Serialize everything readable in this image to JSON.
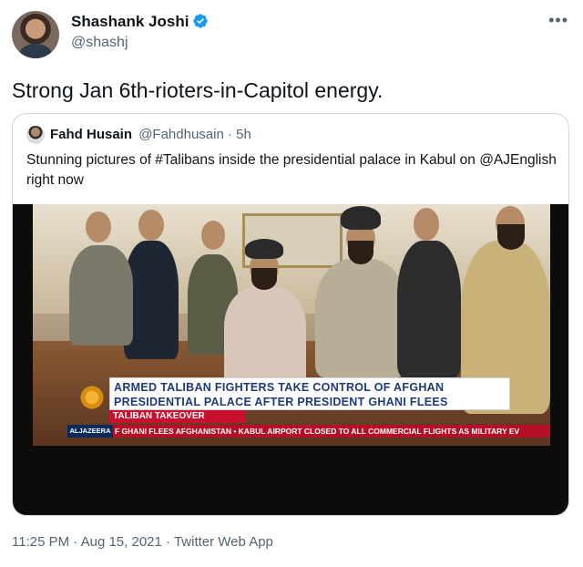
{
  "tweet": {
    "author": {
      "name": "Shashank Joshi",
      "handle": "@shashj",
      "verified": true
    },
    "more_icon": "more-horizontal-icon",
    "text": "Strong Jan 6th-rioters-in-Capitol energy.",
    "quote": {
      "author_name": "Fahd Husain",
      "author_handle": "@Fahdhusain",
      "separator": "·",
      "time": "5h",
      "text": "Stunning pictures of #Talibans inside the presidential palace in Kabul on @AJEnglish right now",
      "media": {
        "headline_line1": "ARMED TALIBAN FIGHTERS TAKE CONTROL OF AFGHAN",
        "headline_line2": "PRESIDENTIAL PALACE AFTER PRESIDENT GHANI FLEES",
        "banner": "TALIBAN TAKEOVER",
        "channel_logo": "ALJAZEERA",
        "ticker": "F GHANI FLEES AFGHANISTAN  •  KABUL AIRPORT CLOSED TO ALL COMMERCIAL FLIGHTS AS MILITARY EV"
      }
    },
    "footer": {
      "time": "11:25 PM",
      "separator": "·",
      "date": "Aug 15, 2021",
      "source": "Twitter Web App"
    }
  },
  "colors": {
    "verified": "#1d9bf0",
    "secondary_text": "#536471",
    "border": "#cfd9de",
    "news_red": "#c8102e"
  }
}
